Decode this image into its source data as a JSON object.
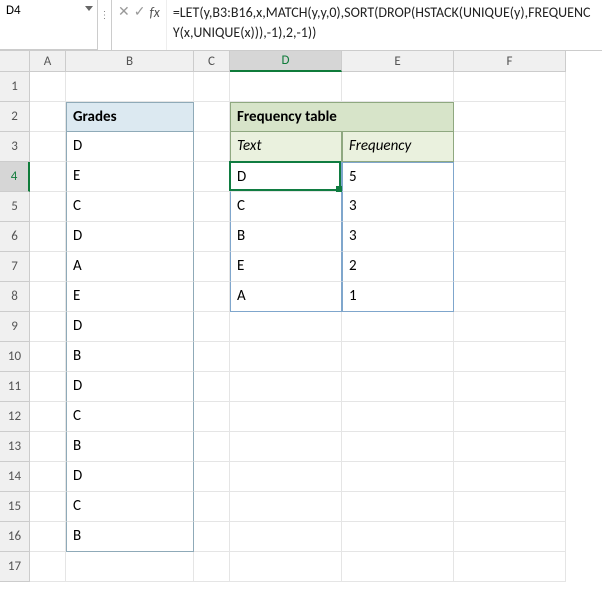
{
  "formula_bar": {
    "namebox": "D4",
    "cancel": "✕",
    "enter": "✓",
    "fx": "fx",
    "formula": "=LET(y,B3:B16,x,MATCH(y,y,0),SORT(DROP(HSTACK(UNIQUE(y),FREQUENCY(x,UNIQUE(x))),-1),2,-1))"
  },
  "columns": [
    "A",
    "B",
    "C",
    "D",
    "E",
    "F"
  ],
  "rows": [
    "1",
    "2",
    "3",
    "4",
    "5",
    "6",
    "7",
    "8",
    "9",
    "10",
    "11",
    "12",
    "13",
    "14",
    "15",
    "16",
    "17"
  ],
  "active_col": "D",
  "active_row": "4",
  "grades": {
    "header": "Grades",
    "values": [
      "D",
      "E",
      "C",
      "D",
      "A",
      "E",
      "D",
      "B",
      "D",
      "C",
      "B",
      "D",
      "C",
      "B"
    ]
  },
  "freq": {
    "title": "Frequency table",
    "sub_text": "Text",
    "sub_freq": "Frequency",
    "rows": [
      {
        "text": "D",
        "freq": "5"
      },
      {
        "text": "C",
        "freq": "3"
      },
      {
        "text": "B",
        "freq": "3"
      },
      {
        "text": "E",
        "freq": "2"
      },
      {
        "text": "A",
        "freq": "1"
      }
    ]
  },
  "chart_data": {
    "type": "table",
    "title": "Frequency table",
    "columns": [
      "Text",
      "Frequency"
    ],
    "rows": [
      [
        "D",
        5
      ],
      [
        "C",
        3
      ],
      [
        "B",
        3
      ],
      [
        "E",
        2
      ],
      [
        "A",
        1
      ]
    ]
  }
}
